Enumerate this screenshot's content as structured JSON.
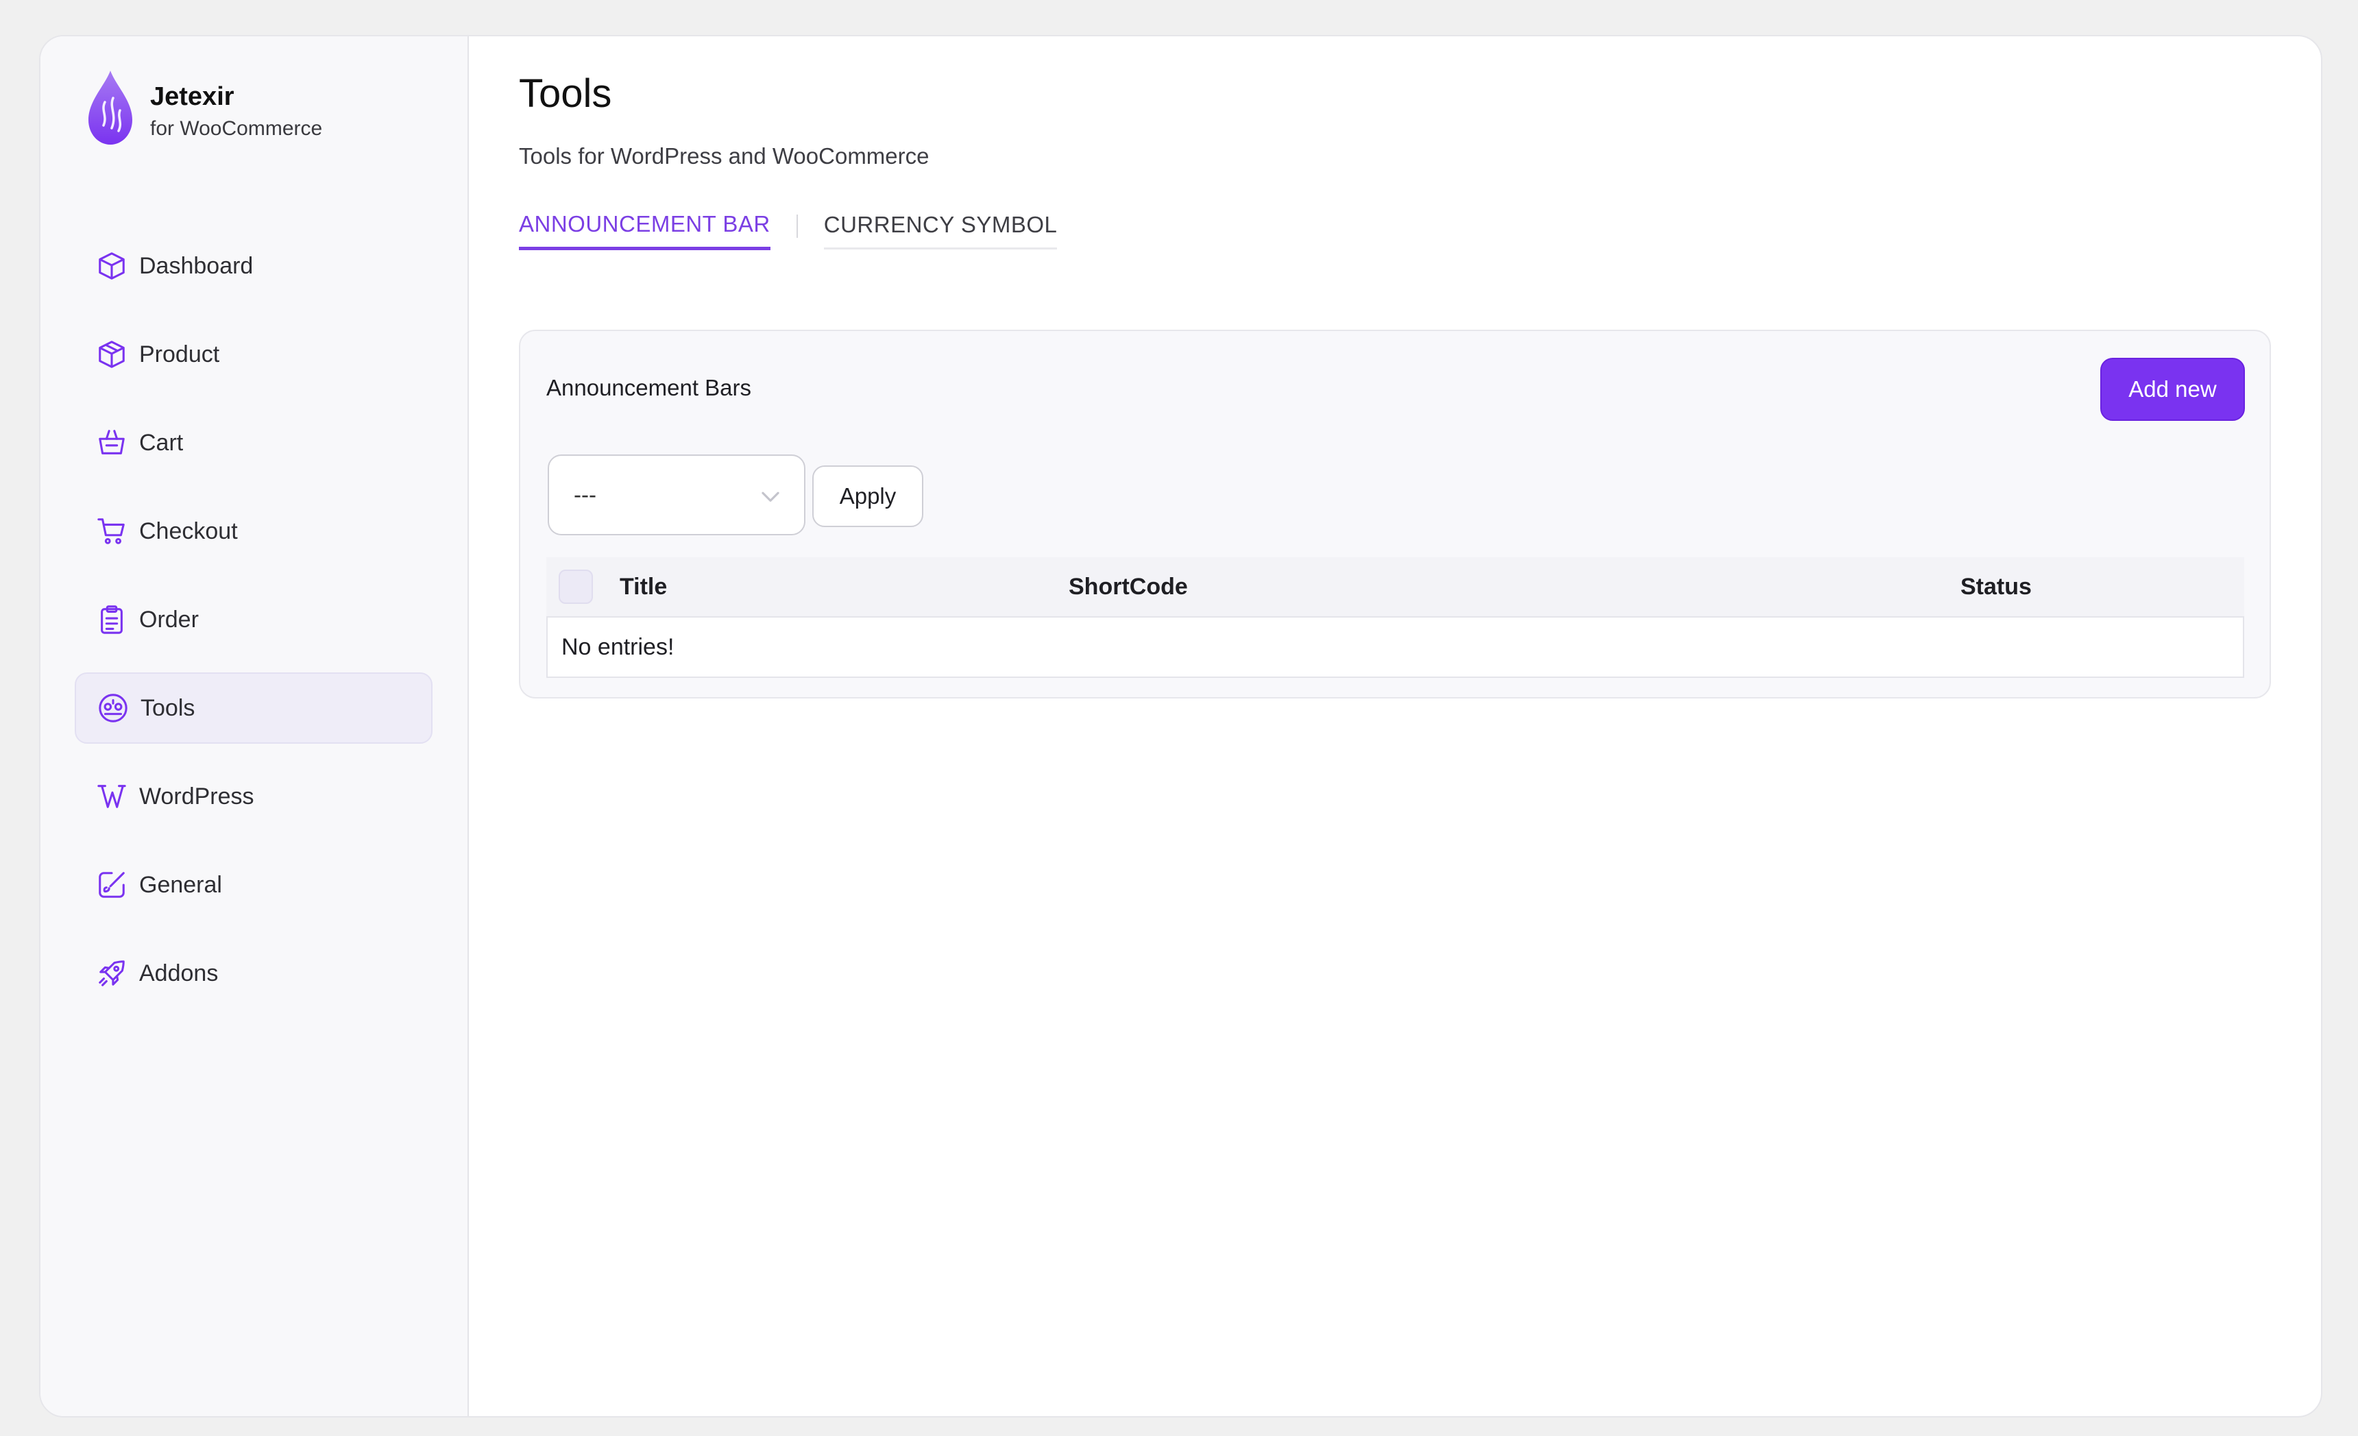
{
  "brand": {
    "name": "Jetexir",
    "subtitle": "for WooCommerce",
    "logo_icon": "flame-drop-logo",
    "accent_color": "#7a33f0"
  },
  "sidebar": {
    "items": [
      {
        "label": "Dashboard",
        "icon": "cube-icon",
        "active": false
      },
      {
        "label": "Product",
        "icon": "package-icon",
        "active": false
      },
      {
        "label": "Cart",
        "icon": "basket-icon",
        "active": false
      },
      {
        "label": "Checkout",
        "icon": "cart-icon",
        "active": false
      },
      {
        "label": "Order",
        "icon": "clipboard-icon",
        "active": false
      },
      {
        "label": "Tools",
        "icon": "tools-icon",
        "active": true
      },
      {
        "label": "WordPress",
        "icon": "wordpress-icon",
        "active": false
      },
      {
        "label": "General",
        "icon": "brush-icon",
        "active": false
      },
      {
        "label": "Addons",
        "icon": "rocket-icon",
        "active": false
      }
    ]
  },
  "page": {
    "title": "Tools",
    "subtitle": "Tools for WordPress and WooCommerce"
  },
  "tabs": [
    {
      "label": "ANNOUNCEMENT BAR",
      "active": true
    },
    {
      "label": "CURRENCY SYMBOL",
      "active": false
    }
  ],
  "panel": {
    "title": "Announcement Bars",
    "add_button": "Add new",
    "bulk_action": {
      "selected": "---"
    },
    "apply_button": "Apply",
    "columns": [
      "Title",
      "ShortCode",
      "Status"
    ],
    "empty_message": "No entries!"
  }
}
